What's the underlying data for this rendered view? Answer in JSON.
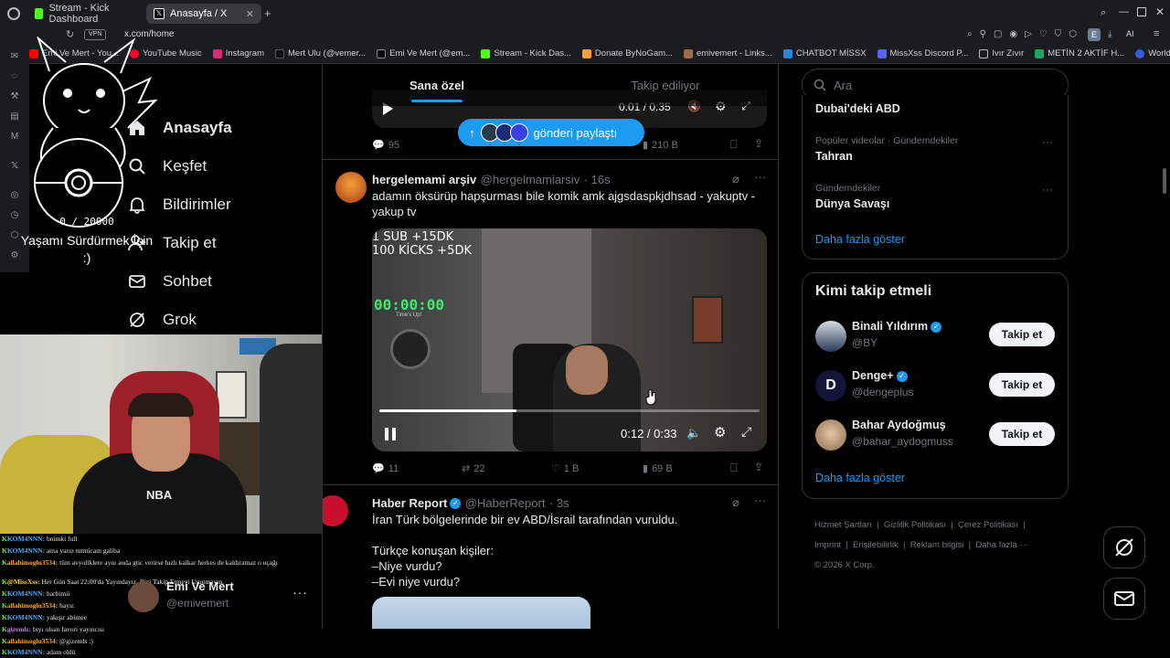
{
  "browser": {
    "tabs": [
      {
        "label": "Stream - Kick Dashboard",
        "active": false
      },
      {
        "label": "Anasayfa / X",
        "active": true
      }
    ],
    "url": "x.com/home",
    "vpn_label": "VPN",
    "profile_letter": "E",
    "ai_label": "AI",
    "bookmarks": [
      "Emi Ve Mert - You...",
      "YouTube Music",
      "Instagram",
      "Mert Ulu (@vemer...",
      "Emi Ve Mert (@em...",
      "Stream - Kick Das...",
      "Donate ByNoGam...",
      "emivemert - Links...",
      "CHATBOT MİSSX",
      "MissXss Discord P...",
      "Ivır Zıvır",
      "METİN 2 AKTİF H...",
      "World Monitor - R..."
    ]
  },
  "overlay": {
    "counter": "0 / 20000",
    "goal_text": "Yaşamı Sürdürmek İçin :)",
    "timer": "00:00:00",
    "timer_sub": "Time's Up!",
    "sub_info_1": "1 SUB +15DK",
    "sub_info_2": "100 KİCKS +5DK",
    "chat": [
      {
        "user": "KOM4NNN:",
        "text": "bnimki full"
      },
      {
        "user": "KOM4NNN:",
        "text": "ama yarın tutmicam galiba"
      },
      {
        "user": "allahimoglu3534:",
        "text": "tüm avyoliklere aynı anda gtic verirse hızlı kalkar herkes de kaldıramaz o uçağı"
      },
      {
        "user": "@MissXss:",
        "text": "Her Gün Saat 22:00'da Yayındayız. Bizi Takip Etmeyi Unutmayın."
      },
      {
        "user": "KOM4NNN:",
        "text": "harbimii"
      },
      {
        "user": "allahimoglu3534:",
        "text": "hayır."
      },
      {
        "user": "KOM4NNN:",
        "text": "yakışır abimee"
      },
      {
        "user": "gizemls:",
        "text": "bıyı olsan favori yayıncısı"
      },
      {
        "user": "allahimoglu3534:",
        "text": "@gizemls :)"
      },
      {
        "user": "KOM4NNN:",
        "text": "adam oldü"
      }
    ]
  },
  "nav": {
    "items": [
      {
        "label": "Anasayfa",
        "icon": "home-icon"
      },
      {
        "label": "Keşfet",
        "icon": "search-icon"
      },
      {
        "label": "Bildirimler",
        "icon": "bell-icon"
      },
      {
        "label": "Takip et",
        "icon": "follow-icon"
      },
      {
        "label": "Sohbet",
        "icon": "mail-icon"
      },
      {
        "label": "Grok",
        "icon": "grok-icon"
      }
    ],
    "account_name": "Emi Ve Mert",
    "account_handle": "@emivemert"
  },
  "feed": {
    "tabs": [
      "Sana özel",
      "Takip ediliyor"
    ],
    "share_pill": "gönderi paylaştı",
    "prev_video": {
      "time": "0:01 / 0:35",
      "replies": "95",
      "views": "210 B"
    },
    "tweet1": {
      "name": "hergelemami arşiv",
      "handle": "@hergelmamiarsiv",
      "time": "· 16s",
      "text": "adamın öksürüp hapşurması bile komik amk ajgsdaspkjdhsad - yakuptv - yakup tv",
      "video_time": "0:12 / 0:33",
      "video_progress": 0.36,
      "replies": "11",
      "reposts": "22",
      "likes": "1 B",
      "views": "69 B"
    },
    "tweet2": {
      "name": "Haber Report",
      "handle": "@HaberReport",
      "time": "· 3s",
      "line1": "İran Türk bölgelerinde bir ev ABD/İsrail tarafından vuruldu.",
      "line2": "Türkçe konuşan kişiler:",
      "line3": "–Niye vurdu?",
      "line4": "–Evi niye vurdu?"
    }
  },
  "right": {
    "search_placeholder": "Ara",
    "trends": [
      {
        "meta": "",
        "title": "Dubai'deki ABD"
      },
      {
        "meta": "Popüler videolar · Gündemdekiler",
        "title": "Tahran"
      },
      {
        "meta": "Gündemdekiler",
        "title": "Dünya Savaşı"
      }
    ],
    "show_more": "Daha fazla göster",
    "who_to_follow_title": "Kimi takip etmeli",
    "who_to_follow": [
      {
        "name": "Binali Yıldırım",
        "handle": "@BY"
      },
      {
        "name": "Denge+",
        "handle": "@dengeplus"
      },
      {
        "name": "Bahar Aydoğmuş",
        "handle": "@bahar_aydogmuss"
      }
    ],
    "follow_label": "Takip et",
    "show_more_2": "Daha fazla göster",
    "footer_1": [
      "Hizmet Şartları",
      "Gizlilik Politikası",
      "Çerez Politikası"
    ],
    "footer_2": [
      "Imprint",
      "Erişilebilirlik",
      "Reklam bilgisi",
      "Daha fazla ···"
    ],
    "copyright": "© 2026 X Corp."
  },
  "colors": {
    "accent": "#1d9bf0",
    "kick_green": "#53fc18",
    "timer_green": "#3fe86a"
  }
}
